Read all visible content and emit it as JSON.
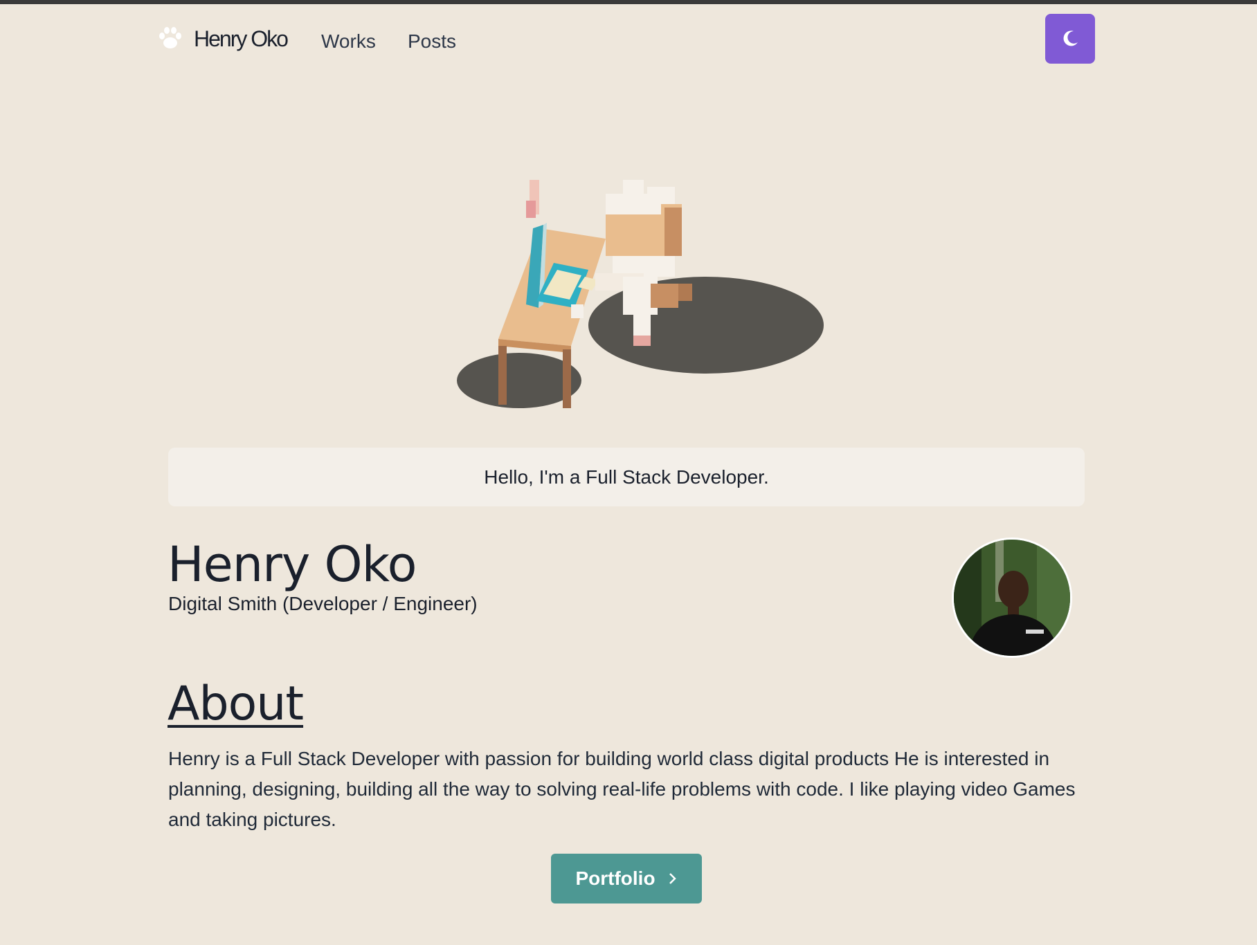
{
  "header": {
    "logo_text": "Henry Oko",
    "nav": [
      {
        "label": "Works"
      },
      {
        "label": "Posts"
      }
    ],
    "theme_icon": "moon-icon",
    "accent": "#805ad5"
  },
  "banner": {
    "text": "Hello, I'm a Full Stack Developer."
  },
  "profile": {
    "name": "Henry Oko",
    "role": "Digital Smith (Developer / Engineer)"
  },
  "about": {
    "title": "About",
    "body": "Henry is a Full Stack Developer with passion for building world class digital products He is interested in planning, designing, building all the way to solving real-life problems with code. I like playing video Games and taking pictures."
  },
  "cta": {
    "label": "Portfolio",
    "icon": "chevron-right-icon",
    "color": "#4d9893"
  }
}
